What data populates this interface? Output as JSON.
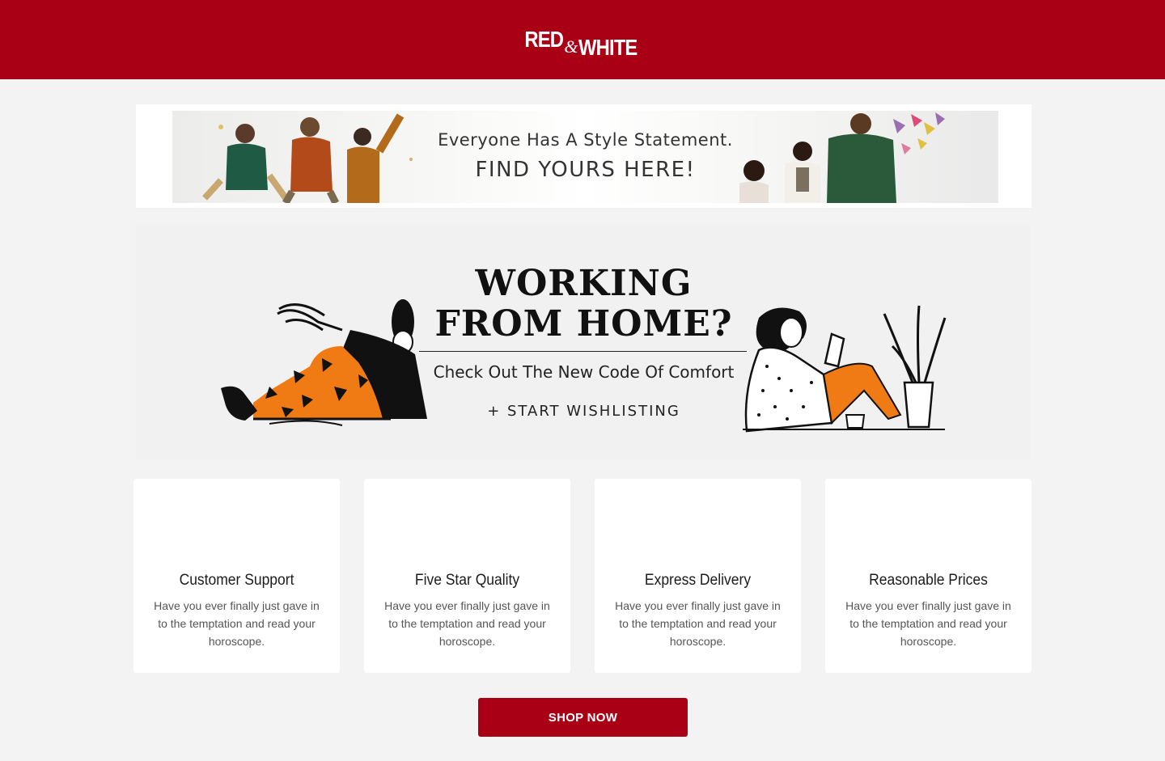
{
  "brand": {
    "logo_part1": "RED",
    "logo_amp": "&",
    "logo_part2": "WHITE",
    "color": "#a90016"
  },
  "promo_banner": {
    "line1": "Everyone Has A Style Statement.",
    "line2": "FIND YOURS HERE!"
  },
  "wfh_banner": {
    "title_line1": "WORKING",
    "title_line2": "FROM HOME?",
    "subtitle": "Check Out The New Code Of Comfort",
    "cta": "+ START WISHLISTING"
  },
  "features": [
    {
      "title": "Customer Support",
      "description": "Have you ever finally just gave in to the temptation and read your horoscope."
    },
    {
      "title": "Five Star Quality",
      "description": "Have you ever finally just gave in to the temptation and read your horoscope."
    },
    {
      "title": "Express Delivery",
      "description": "Have you ever finally just gave in to the temptation and read your horoscope."
    },
    {
      "title": "Reasonable Prices",
      "description": "Have you ever finally just gave in to the temptation and read your horoscope."
    }
  ],
  "shop_button": {
    "label": "SHOP NOW"
  }
}
